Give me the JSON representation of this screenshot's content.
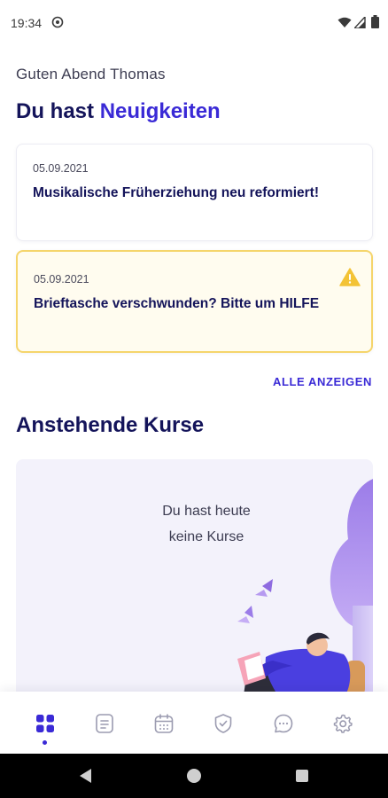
{
  "status_bar": {
    "time": "19:34"
  },
  "greeting": "Guten Abend Thomas",
  "news": {
    "heading_prefix": "Du hast",
    "heading_accent": "Neuigkeiten",
    "items": [
      {
        "date": "05.09.2021",
        "title": "Musikalische Früherziehung neu reformiert!",
        "warning": false
      },
      {
        "date": "05.09.2021",
        "title": "Brieftasche verschwunden? Bitte um HILFE",
        "warning": true
      }
    ],
    "show_all_label": "ALLE ANZEIGEN"
  },
  "courses": {
    "heading": "Anstehende Kurse",
    "empty_line1": "Du hast heute",
    "empty_line2": "keine Kurse"
  },
  "bottom_nav": {
    "active_index": 0,
    "items": [
      "dashboard-icon",
      "document-icon",
      "calendar-icon",
      "shield-check-icon",
      "chat-icon",
      "gear-icon"
    ]
  },
  "colors": {
    "primary": "#3a2ad6",
    "heading": "#14145a",
    "warning_border": "#f5d56c",
    "warning_bg": "#fffcef",
    "warning_icon": "#f3c336",
    "card_bg": "#f3f2fb"
  }
}
